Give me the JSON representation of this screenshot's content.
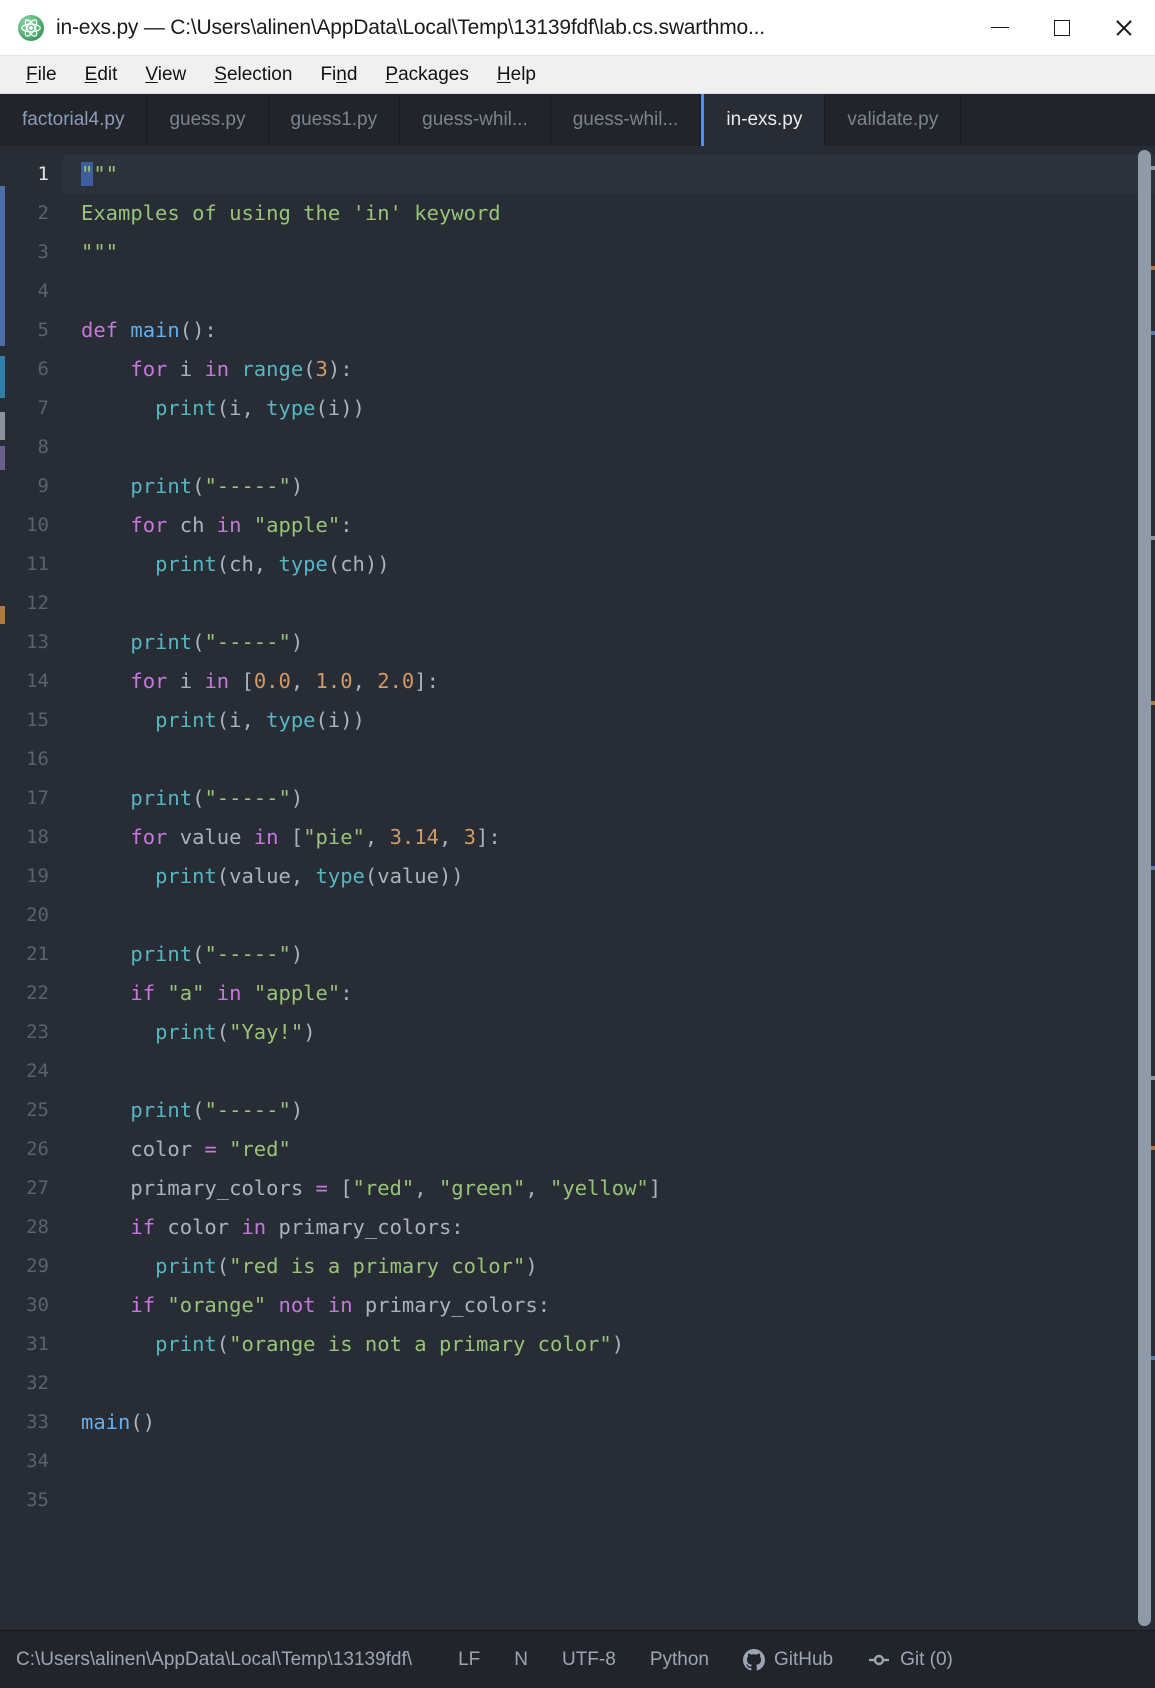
{
  "window": {
    "title": "in-exs.py — C:\\Users\\alinen\\AppData\\Local\\Temp\\13139fdf\\lab.cs.swarthmo...",
    "app_icon": "atom-icon",
    "controls": {
      "minimize": "minimize-icon",
      "maximize": "maximize-icon",
      "close": "close-icon"
    }
  },
  "menubar": {
    "items": [
      {
        "label": "File",
        "mnemonic": "F"
      },
      {
        "label": "Edit",
        "mnemonic": "E"
      },
      {
        "label": "View",
        "mnemonic": "V"
      },
      {
        "label": "Selection",
        "mnemonic": "S"
      },
      {
        "label": "Find",
        "mnemonic": "n"
      },
      {
        "label": "Packages",
        "mnemonic": "P"
      },
      {
        "label": "Help",
        "mnemonic": "H"
      }
    ]
  },
  "tabs": [
    {
      "label": "factorial4.py",
      "active": false,
      "modified": true
    },
    {
      "label": "guess.py",
      "active": false,
      "modified": false
    },
    {
      "label": "guess1.py",
      "active": false,
      "modified": false
    },
    {
      "label": "guess-whil...",
      "active": false,
      "modified": false
    },
    {
      "label": "guess-whil...",
      "active": false,
      "modified": false
    },
    {
      "label": "in-exs.py",
      "active": true,
      "modified": false
    },
    {
      "label": "validate.py",
      "active": false,
      "modified": false
    }
  ],
  "editor": {
    "language": "Python",
    "cursor_line": 1,
    "selection_text": "\"",
    "lines": [
      {
        "n": 1,
        "tokens": [
          {
            "t": "sel",
            "v": "\""
          },
          {
            "t": "str",
            "v": "\"\""
          }
        ]
      },
      {
        "n": 2,
        "tokens": [
          {
            "t": "str",
            "v": "Examples of using the 'in' keyword"
          }
        ]
      },
      {
        "n": 3,
        "tokens": [
          {
            "t": "str",
            "v": "\"\"\""
          }
        ]
      },
      {
        "n": 4,
        "tokens": []
      },
      {
        "n": 5,
        "tokens": [
          {
            "t": "kw",
            "v": "def"
          },
          {
            "t": "var",
            "v": " "
          },
          {
            "t": "def",
            "v": "main"
          },
          {
            "t": "punc",
            "v": "():"
          }
        ]
      },
      {
        "n": 6,
        "tokens": [
          {
            "t": "var",
            "v": "    "
          },
          {
            "t": "kw",
            "v": "for"
          },
          {
            "t": "var",
            "v": " i "
          },
          {
            "t": "kw",
            "v": "in"
          },
          {
            "t": "var",
            "v": " "
          },
          {
            "t": "fn",
            "v": "range"
          },
          {
            "t": "punc",
            "v": "("
          },
          {
            "t": "num",
            "v": "3"
          },
          {
            "t": "punc",
            "v": "):"
          }
        ]
      },
      {
        "n": 7,
        "tokens": [
          {
            "t": "var",
            "v": "      "
          },
          {
            "t": "fn",
            "v": "print"
          },
          {
            "t": "punc",
            "v": "("
          },
          {
            "t": "var",
            "v": "i, "
          },
          {
            "t": "fn",
            "v": "type"
          },
          {
            "t": "punc",
            "v": "("
          },
          {
            "t": "var",
            "v": "i"
          },
          {
            "t": "punc",
            "v": "))"
          }
        ]
      },
      {
        "n": 8,
        "tokens": []
      },
      {
        "n": 9,
        "tokens": [
          {
            "t": "var",
            "v": "    "
          },
          {
            "t": "fn",
            "v": "print"
          },
          {
            "t": "punc",
            "v": "("
          },
          {
            "t": "str",
            "v": "\"-----\""
          },
          {
            "t": "punc",
            "v": ")"
          }
        ]
      },
      {
        "n": 10,
        "tokens": [
          {
            "t": "var",
            "v": "    "
          },
          {
            "t": "kw",
            "v": "for"
          },
          {
            "t": "var",
            "v": " ch "
          },
          {
            "t": "kw",
            "v": "in"
          },
          {
            "t": "var",
            "v": " "
          },
          {
            "t": "str",
            "v": "\"apple\""
          },
          {
            "t": "punc",
            "v": ":"
          }
        ]
      },
      {
        "n": 11,
        "tokens": [
          {
            "t": "var",
            "v": "      "
          },
          {
            "t": "fn",
            "v": "print"
          },
          {
            "t": "punc",
            "v": "("
          },
          {
            "t": "var",
            "v": "ch, "
          },
          {
            "t": "fn",
            "v": "type"
          },
          {
            "t": "punc",
            "v": "("
          },
          {
            "t": "var",
            "v": "ch"
          },
          {
            "t": "punc",
            "v": "))"
          }
        ]
      },
      {
        "n": 12,
        "tokens": []
      },
      {
        "n": 13,
        "tokens": [
          {
            "t": "var",
            "v": "    "
          },
          {
            "t": "fn",
            "v": "print"
          },
          {
            "t": "punc",
            "v": "("
          },
          {
            "t": "str",
            "v": "\"-----\""
          },
          {
            "t": "punc",
            "v": ")"
          }
        ]
      },
      {
        "n": 14,
        "tokens": [
          {
            "t": "var",
            "v": "    "
          },
          {
            "t": "kw",
            "v": "for"
          },
          {
            "t": "var",
            "v": " i "
          },
          {
            "t": "kw",
            "v": "in"
          },
          {
            "t": "var",
            "v": " "
          },
          {
            "t": "punc",
            "v": "["
          },
          {
            "t": "num",
            "v": "0.0"
          },
          {
            "t": "punc",
            "v": ", "
          },
          {
            "t": "num",
            "v": "1.0"
          },
          {
            "t": "punc",
            "v": ", "
          },
          {
            "t": "num",
            "v": "2.0"
          },
          {
            "t": "punc",
            "v": "]:"
          }
        ]
      },
      {
        "n": 15,
        "tokens": [
          {
            "t": "var",
            "v": "      "
          },
          {
            "t": "fn",
            "v": "print"
          },
          {
            "t": "punc",
            "v": "("
          },
          {
            "t": "var",
            "v": "i, "
          },
          {
            "t": "fn",
            "v": "type"
          },
          {
            "t": "punc",
            "v": "("
          },
          {
            "t": "var",
            "v": "i"
          },
          {
            "t": "punc",
            "v": "))"
          }
        ]
      },
      {
        "n": 16,
        "tokens": []
      },
      {
        "n": 17,
        "tokens": [
          {
            "t": "var",
            "v": "    "
          },
          {
            "t": "fn",
            "v": "print"
          },
          {
            "t": "punc",
            "v": "("
          },
          {
            "t": "str",
            "v": "\"-----\""
          },
          {
            "t": "punc",
            "v": ")"
          }
        ]
      },
      {
        "n": 18,
        "tokens": [
          {
            "t": "var",
            "v": "    "
          },
          {
            "t": "kw",
            "v": "for"
          },
          {
            "t": "var",
            "v": " value "
          },
          {
            "t": "kw",
            "v": "in"
          },
          {
            "t": "var",
            "v": " "
          },
          {
            "t": "punc",
            "v": "["
          },
          {
            "t": "str",
            "v": "\"pie\""
          },
          {
            "t": "punc",
            "v": ", "
          },
          {
            "t": "num",
            "v": "3.14"
          },
          {
            "t": "punc",
            "v": ", "
          },
          {
            "t": "num",
            "v": "3"
          },
          {
            "t": "punc",
            "v": "]:"
          }
        ]
      },
      {
        "n": 19,
        "tokens": [
          {
            "t": "var",
            "v": "      "
          },
          {
            "t": "fn",
            "v": "print"
          },
          {
            "t": "punc",
            "v": "("
          },
          {
            "t": "var",
            "v": "value, "
          },
          {
            "t": "fn",
            "v": "type"
          },
          {
            "t": "punc",
            "v": "("
          },
          {
            "t": "var",
            "v": "value"
          },
          {
            "t": "punc",
            "v": "))"
          }
        ]
      },
      {
        "n": 20,
        "tokens": []
      },
      {
        "n": 21,
        "tokens": [
          {
            "t": "var",
            "v": "    "
          },
          {
            "t": "fn",
            "v": "print"
          },
          {
            "t": "punc",
            "v": "("
          },
          {
            "t": "str",
            "v": "\"-----\""
          },
          {
            "t": "punc",
            "v": ")"
          }
        ]
      },
      {
        "n": 22,
        "tokens": [
          {
            "t": "var",
            "v": "    "
          },
          {
            "t": "kw",
            "v": "if"
          },
          {
            "t": "var",
            "v": " "
          },
          {
            "t": "str",
            "v": "\"a\""
          },
          {
            "t": "var",
            "v": " "
          },
          {
            "t": "kw",
            "v": "in"
          },
          {
            "t": "var",
            "v": " "
          },
          {
            "t": "str",
            "v": "\"apple\""
          },
          {
            "t": "punc",
            "v": ":"
          }
        ]
      },
      {
        "n": 23,
        "tokens": [
          {
            "t": "var",
            "v": "      "
          },
          {
            "t": "fn",
            "v": "print"
          },
          {
            "t": "punc",
            "v": "("
          },
          {
            "t": "str",
            "v": "\"Yay!\""
          },
          {
            "t": "punc",
            "v": ")"
          }
        ]
      },
      {
        "n": 24,
        "tokens": []
      },
      {
        "n": 25,
        "tokens": [
          {
            "t": "var",
            "v": "    "
          },
          {
            "t": "fn",
            "v": "print"
          },
          {
            "t": "punc",
            "v": "("
          },
          {
            "t": "str",
            "v": "\"-----\""
          },
          {
            "t": "punc",
            "v": ")"
          }
        ]
      },
      {
        "n": 26,
        "tokens": [
          {
            "t": "var",
            "v": "    color "
          },
          {
            "t": "op",
            "v": "="
          },
          {
            "t": "var",
            "v": " "
          },
          {
            "t": "str",
            "v": "\"red\""
          }
        ]
      },
      {
        "n": 27,
        "tokens": [
          {
            "t": "var",
            "v": "    primary_colors "
          },
          {
            "t": "op",
            "v": "="
          },
          {
            "t": "var",
            "v": " "
          },
          {
            "t": "punc",
            "v": "["
          },
          {
            "t": "str",
            "v": "\"red\""
          },
          {
            "t": "punc",
            "v": ", "
          },
          {
            "t": "str",
            "v": "\"green\""
          },
          {
            "t": "punc",
            "v": ", "
          },
          {
            "t": "str",
            "v": "\"yellow\""
          },
          {
            "t": "punc",
            "v": "]"
          }
        ]
      },
      {
        "n": 28,
        "tokens": [
          {
            "t": "var",
            "v": "    "
          },
          {
            "t": "kw",
            "v": "if"
          },
          {
            "t": "var",
            "v": " color "
          },
          {
            "t": "kw",
            "v": "in"
          },
          {
            "t": "var",
            "v": " primary_colors"
          },
          {
            "t": "punc",
            "v": ":"
          }
        ]
      },
      {
        "n": 29,
        "tokens": [
          {
            "t": "var",
            "v": "      "
          },
          {
            "t": "fn",
            "v": "print"
          },
          {
            "t": "punc",
            "v": "("
          },
          {
            "t": "str",
            "v": "\"red is a primary color\""
          },
          {
            "t": "punc",
            "v": ")"
          }
        ]
      },
      {
        "n": 30,
        "tokens": [
          {
            "t": "var",
            "v": "    "
          },
          {
            "t": "kw",
            "v": "if"
          },
          {
            "t": "var",
            "v": " "
          },
          {
            "t": "str",
            "v": "\"orange\""
          },
          {
            "t": "var",
            "v": " "
          },
          {
            "t": "kw",
            "v": "not"
          },
          {
            "t": "var",
            "v": " "
          },
          {
            "t": "kw",
            "v": "in"
          },
          {
            "t": "var",
            "v": " primary_colors"
          },
          {
            "t": "punc",
            "v": ":"
          }
        ]
      },
      {
        "n": 31,
        "tokens": [
          {
            "t": "var",
            "v": "      "
          },
          {
            "t": "fn",
            "v": "print"
          },
          {
            "t": "punc",
            "v": "("
          },
          {
            "t": "str",
            "v": "\"orange is not a primary color\""
          },
          {
            "t": "punc",
            "v": ")"
          }
        ]
      },
      {
        "n": 32,
        "tokens": []
      },
      {
        "n": 33,
        "tokens": [
          {
            "t": "def",
            "v": "main"
          },
          {
            "t": "punc",
            "v": "()"
          }
        ]
      },
      {
        "n": 34,
        "tokens": []
      },
      {
        "n": 35,
        "tokens": []
      }
    ]
  },
  "statusbar": {
    "path": "C:\\Users\\alinen\\AppData\\Local\\Temp\\13139fdf\\",
    "line_ending": "LF",
    "indent": "N",
    "encoding": "UTF-8",
    "grammar": "Python",
    "github": {
      "icon": "github-icon",
      "label": "GitHub"
    },
    "git": {
      "icon": "git-branch-icon",
      "label": "Git (0)"
    }
  },
  "colors": {
    "editor_bg": "#282c34",
    "chrome_bg": "#21252b",
    "accent_blue": "#4d92e8",
    "keyword": "#c678dd",
    "function": "#56b6c2",
    "string": "#98c379",
    "number": "#d19a66",
    "variable": "#abb2bf",
    "definition": "#61afef",
    "gutter_text": "#5a626f",
    "status_text": "#9da5b4"
  }
}
